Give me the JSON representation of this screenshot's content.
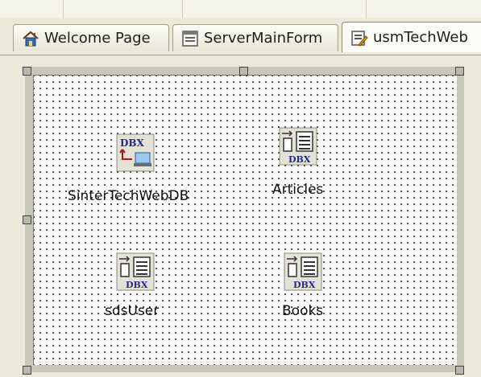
{
  "tabs": [
    {
      "label": "Welcome Page",
      "icon": "house-icon"
    },
    {
      "label": "ServerMainForm",
      "icon": "form-icon"
    },
    {
      "label": "usmTechWeb",
      "icon": "datamodule-edit-icon",
      "active": true
    }
  ],
  "components": [
    {
      "label": "SinterTechWebDB",
      "icon": "dbx-connection-icon"
    },
    {
      "label": "Articles",
      "icon": "dbx-dataset-icon"
    },
    {
      "label": "sdsUser",
      "icon": "dbx-dataset-icon"
    },
    {
      "label": "Books",
      "icon": "dbx-dataset-icon"
    }
  ],
  "icon_text": {
    "dbx": "DBX"
  }
}
